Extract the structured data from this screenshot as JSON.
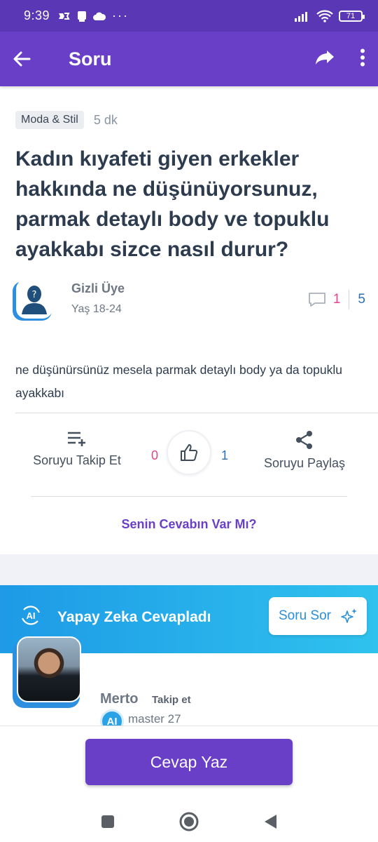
{
  "status_bar": {
    "time": "9:39",
    "battery": "71"
  },
  "app_bar": {
    "title": "Soru"
  },
  "question": {
    "category": "Moda & Stil",
    "time_ago": "5 dk",
    "title": "Kadın kıyafeti giyen erkekler hakkında ne düşünüyorsunuz, parmak detaylı body ve topuklu ayakkabı sizce nasıl durur?",
    "author_name": "Gizli Üye",
    "author_age": "Yaş 18-24",
    "comment_count": "1",
    "view_count": "5",
    "body": "ne düşünürsünüz mesela parmak detaylı body ya da topuklu ayakkabı"
  },
  "actions": {
    "follow_label": "Soruyu Takip Et",
    "dislike_count": "0",
    "like_count": "1",
    "share_label": "Soruyu Paylaş",
    "your_answer_prompt": "Senin Cevabın Var Mı?"
  },
  "ai_banner": {
    "logo_text": "AI",
    "title": "Yapay Zeka Cevapladı",
    "ask_button": "Soru Sor"
  },
  "answer": {
    "author_name": "Merto",
    "follow_label": "Takip et",
    "badge": "AI",
    "level": "master 27"
  },
  "bottom": {
    "cta": "Cevap Yaz"
  },
  "colors": {
    "primary": "#6a3fc8",
    "status": "#5a37b5",
    "accent_pink": "#e2458a",
    "accent_blue": "#2b6fb4",
    "ai_blue": "#1e9ae6"
  }
}
